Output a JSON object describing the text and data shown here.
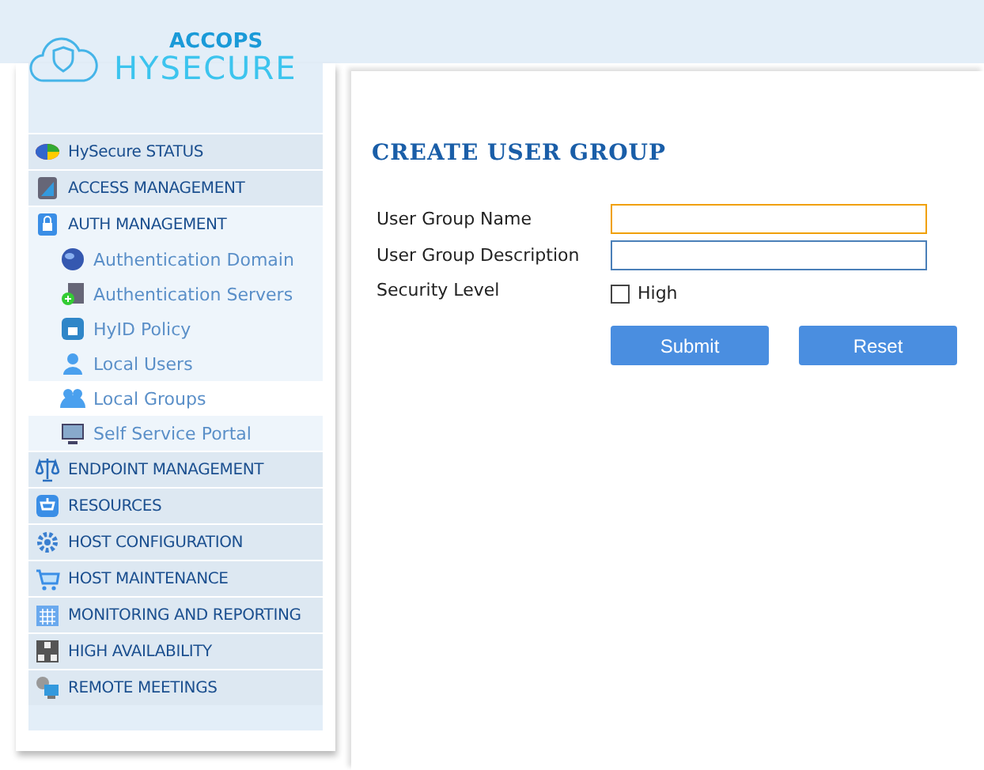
{
  "logo": {
    "brand": "ACCOPS",
    "product": "HYSECURE"
  },
  "sidebar": {
    "items": [
      {
        "label": "HySecure STATUS",
        "expanded": false
      },
      {
        "label": "ACCESS MANAGEMENT",
        "expanded": false
      },
      {
        "label": "AUTH MANAGEMENT",
        "expanded": true,
        "children": [
          {
            "label": "Authentication Domain",
            "selected": false
          },
          {
            "label": "Authentication Servers",
            "selected": false
          },
          {
            "label": "HyID Policy",
            "selected": false
          },
          {
            "label": "Local Users",
            "selected": false
          },
          {
            "label": "Local Groups",
            "selected": true
          },
          {
            "label": "Self Service Portal",
            "selected": false
          }
        ]
      },
      {
        "label": "ENDPOINT MANAGEMENT",
        "expanded": false
      },
      {
        "label": "RESOURCES",
        "expanded": false
      },
      {
        "label": "HOST CONFIGURATION",
        "expanded": false
      },
      {
        "label": "HOST MAINTENANCE",
        "expanded": false
      },
      {
        "label": "MONITORING AND REPORTING",
        "expanded": false
      },
      {
        "label": "HIGH AVAILABILITY",
        "expanded": false
      },
      {
        "label": "REMOTE MEETINGS",
        "expanded": false
      }
    ]
  },
  "form": {
    "title": "CREATE USER GROUP",
    "fields": [
      {
        "kind": "text",
        "label": "User Group Name",
        "focused": true
      },
      {
        "kind": "text",
        "label": "User Group Description",
        "focused": false
      },
      {
        "kind": "checkbox",
        "label": "Security Level",
        "option": "High",
        "checked": false
      }
    ],
    "buttons": [
      "Submit",
      "Reset"
    ]
  }
}
